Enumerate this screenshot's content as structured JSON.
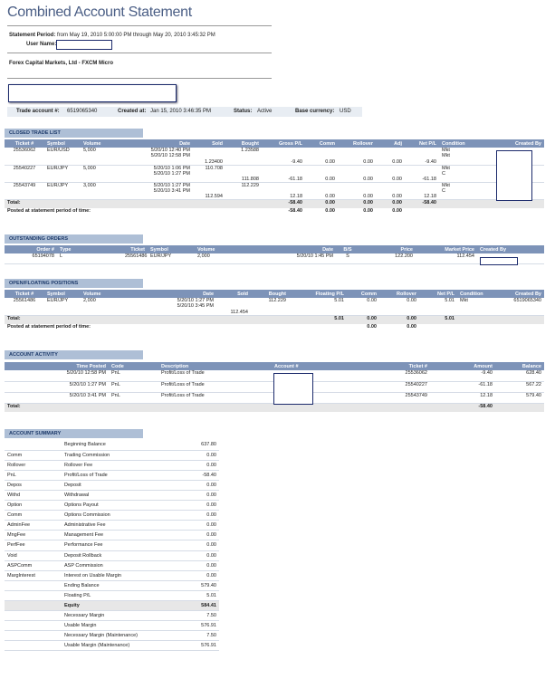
{
  "page_title": "Combined Account Statement",
  "statement": {
    "period_label": "Statement Period:",
    "period_value": "from May 19, 2010 5:00:00 PM through May 20, 2010 3:45:32 PM",
    "user_label": "User Name:"
  },
  "company": "Forex Capital Markets, Ltd - FXCM Micro",
  "account_info": {
    "trade_account_label": "Trade account #:",
    "trade_account": "6519065340",
    "created_label": "Created at:",
    "created": "Jan 15, 2010 3:46:35 PM",
    "status_label": "Status:",
    "status": "Active",
    "currency_label": "Base currency:",
    "currency": "USD"
  },
  "closed": {
    "title": "CLOSED TRADE LIST",
    "headers": [
      "Ticket #",
      "Symbol",
      "Volume",
      "Date",
      "Sold",
      "Bought",
      "Gross P/L",
      "Comm",
      "Rollover",
      "Adj",
      "Net P/L",
      "Condition",
      "Created By"
    ],
    "rows": [
      {
        "ticket": "25536062",
        "symbol": "EUR/USD",
        "volume": "5,000",
        "date1": "5/20/10 12:40 PM",
        "date2": "5/20/10 12:58 PM",
        "sold": "1.23400",
        "bought": "1.23588",
        "gross": "-9.40",
        "comm": "0.00",
        "roll": "0.00",
        "adj": "0.00",
        "net": "-9.40",
        "cond1": "Mkt",
        "cond2": "Mkt"
      },
      {
        "ticket": "25540227",
        "symbol": "EUR/JPY",
        "volume": "5,000",
        "date1": "5/20/10 1:06 PM",
        "date2": "5/20/10 1:27 PM",
        "sold": "110.708",
        "bought": "111.808",
        "gross": "-61.18",
        "comm": "0.00",
        "roll": "0.00",
        "adj": "0.00",
        "net": "-61.18",
        "cond1": "Mkt",
        "cond2": "C"
      },
      {
        "ticket": "25543749",
        "symbol": "EUR/JPY",
        "volume": "3,000",
        "date1": "5/20/10 1:27 PM",
        "date2": "5/20/10 3:41 PM",
        "sold": "112.594",
        "bought": "112.229",
        "gross": "12.18",
        "comm": "0.00",
        "roll": "0.00",
        "adj": "0.00",
        "net": "12.18",
        "cond1": "Mkt",
        "cond2": "C"
      }
    ],
    "total_label": "Total:",
    "total": {
      "gross": "-58.40",
      "comm": "0.00",
      "roll": "0.00",
      "adj": "0.00",
      "net": "-58.40"
    },
    "posted_label": "Posted at statement period of time:",
    "posted": {
      "gross": "-58.40",
      "comm": "0.00",
      "roll": "0.00",
      "adj": "0.00"
    }
  },
  "outstanding": {
    "title": "OUTSTANDING ORDERS",
    "headers": [
      "Order #",
      "Type",
      "Ticket",
      "Symbol",
      "Volume",
      "Date",
      "B/S",
      "Price",
      "Market Price",
      "Created By"
    ],
    "row": {
      "order": "65194078",
      "type": "L",
      "ticket": "25561486",
      "symbol": "EUR/JPY",
      "volume": "2,000",
      "date": "5/20/10 1:45 PM",
      "bs": "S",
      "price": "122.200",
      "market": "112.454"
    }
  },
  "open": {
    "title": "OPEN/FLOATING POSITIONS",
    "headers": [
      "Ticket #",
      "Symbol",
      "Volume",
      "Date",
      "Sold",
      "Bought",
      "Floating P/L",
      "Comm",
      "Rollover",
      "Net P/L",
      "Condition",
      "Created By"
    ],
    "row": {
      "ticket": "25561486",
      "symbol": "EUR/JPY",
      "volume": "2,000",
      "date1": "5/20/10 1:27 PM",
      "date2": "5/20/10 3:45 PM",
      "sold": "112.454",
      "bought": "112.229",
      "floating": "5.01",
      "comm": "0.00",
      "roll": "0.00",
      "net": "5.01",
      "cond": "Mkt",
      "created": "6519065340"
    },
    "total_label": "Total:",
    "total": {
      "floating": "5.01",
      "comm": "0.00",
      "roll": "0.00",
      "net": "5.01"
    },
    "posted_label": "Posted at statement period of time:",
    "posted": {
      "comm": "0.00",
      "roll": "0.00"
    }
  },
  "activity": {
    "title": "ACCOUNT ACTIVITY",
    "headers": [
      "Time Posted",
      "Code",
      "Description",
      "Account #",
      "Ticket #",
      "Amount",
      "Balance"
    ],
    "rows": [
      {
        "time": "5/20/10 12:58 PM",
        "code": "PnL",
        "desc": "Profit/Loss of Trade",
        "ticket": "25536062",
        "amount": "-9.40",
        "balance": "628.40"
      },
      {
        "time": "5/20/10 1:27 PM",
        "code": "PnL",
        "desc": "Profit/Loss of Trade",
        "ticket": "25540227",
        "amount": "-61.18",
        "balance": "567.22"
      },
      {
        "time": "5/20/10 3:41 PM",
        "code": "PnL",
        "desc": "Profit/Loss of Trade",
        "ticket": "25543749",
        "amount": "12.18",
        "balance": "579.40"
      }
    ],
    "total_label": "Total:",
    "total_amount": "-58.40"
  },
  "summary": {
    "title": "ACCOUNT SUMMARY",
    "rows": [
      {
        "code": "",
        "label": "Beginning Balance",
        "value": "637.80"
      },
      {
        "code": "Comm",
        "label": "Trading Commission",
        "value": "0.00"
      },
      {
        "code": "Rollover",
        "label": "Rollover Fee",
        "value": "0.00"
      },
      {
        "code": "PnL",
        "label": "Profit/Loss of Trade",
        "value": "-58.40"
      },
      {
        "code": "Depos",
        "label": "Deposit",
        "value": "0.00"
      },
      {
        "code": "Withd",
        "label": "Withdrawal",
        "value": "0.00"
      },
      {
        "code": "Option",
        "label": "Options Payout",
        "value": "0.00"
      },
      {
        "code": "Comm",
        "label": "Options Commission",
        "value": "0.00"
      },
      {
        "code": "AdminFee",
        "label": "Administrative Fee",
        "value": "0.00"
      },
      {
        "code": "MngFee",
        "label": "Management Fee",
        "value": "0.00"
      },
      {
        "code": "PerfFee",
        "label": "Performance Fee",
        "value": "0.00"
      },
      {
        "code": "Void",
        "label": "Deposit Rollback",
        "value": "0.00"
      },
      {
        "code": "ASPComm",
        "label": "ASP Commission",
        "value": "0.00"
      },
      {
        "code": "MargInterest",
        "label": "Interest on Usable Margin",
        "value": "0.00"
      },
      {
        "code": "",
        "label": "Ending Balance",
        "value": "579.40"
      },
      {
        "code": "",
        "label": "Floating P/L",
        "value": "5.01"
      },
      {
        "code": "",
        "label": "Equity",
        "value": "584.41",
        "bold": true
      },
      {
        "code": "",
        "label": "Necessary Margin",
        "value": "7.50"
      },
      {
        "code": "",
        "label": "Usable Margin",
        "value": "576.91"
      },
      {
        "code": "",
        "label": "Necessary Margin (Maintenance)",
        "value": "7.50"
      },
      {
        "code": "",
        "label": "Usable Margin (Maintenance)",
        "value": "576.91"
      }
    ]
  }
}
